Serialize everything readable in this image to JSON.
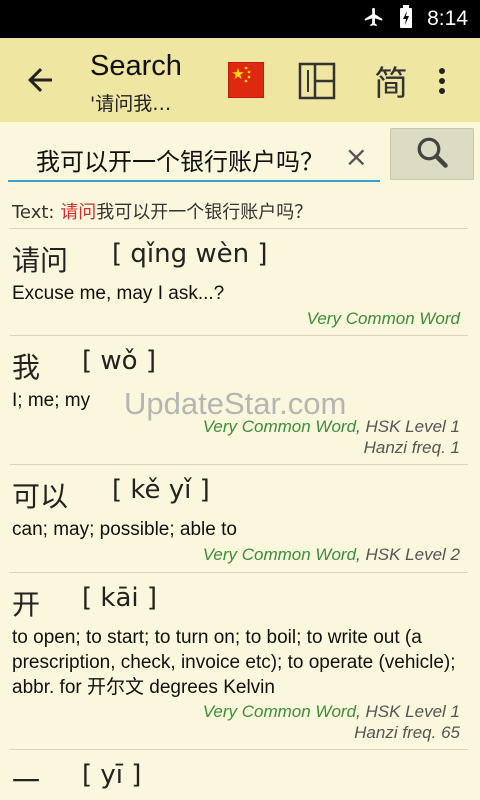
{
  "status_bar": {
    "time": "8:14",
    "icons": [
      "airplane-mode-icon",
      "battery-charging-icon"
    ]
  },
  "app_bar": {
    "title": "Search",
    "subtitle": "'请问我…",
    "simplified_label": "简",
    "icons": [
      "back-arrow-icon",
      "china-flag-icon",
      "layout-icon",
      "overflow-menu-icon"
    ]
  },
  "search": {
    "value": "我可以开一个银行账户吗？",
    "clear": "×",
    "button_icon": "search-icon"
  },
  "text_line": {
    "prefix": "Text: ",
    "highlight": "请问",
    "rest": "我可以开一个银行账户吗？"
  },
  "entries": [
    {
      "hanzi": "请问",
      "pinyin": "[ qǐng wèn ]",
      "definition": "Excuse me, may I ask...?",
      "tags_green": "Very Common Word",
      "tags_rest": "",
      "freq": ""
    },
    {
      "hanzi": "我",
      "pinyin": "[ wǒ ]",
      "definition": "I; me; my",
      "tags_green": "Very Common Word",
      "tags_rest": ", HSK Level 1",
      "freq": "Hanzi freq. 1"
    },
    {
      "hanzi": "可以",
      "pinyin": "[ kě yǐ ]",
      "definition": "can; may; possible; able to",
      "tags_green": "Very Common Word",
      "tags_rest": ", HSK Level 2",
      "freq": ""
    },
    {
      "hanzi": "开",
      "pinyin": "[ kāi ]",
      "definition": "to open; to start; to turn on; to boil; to write out (a prescription, check, invoice etc); to operate (vehicle); abbr. for 开尔文 degrees Kelvin",
      "tags_green": "Very Common Word",
      "tags_rest": ", HSK Level 1",
      "freq": "Hanzi freq. 65"
    },
    {
      "hanzi": "一",
      "pinyin": "[ yī ]",
      "definition": "",
      "tags_green": "",
      "tags_rest": "",
      "freq": ""
    }
  ],
  "watermark": "UpdateStar.com"
}
